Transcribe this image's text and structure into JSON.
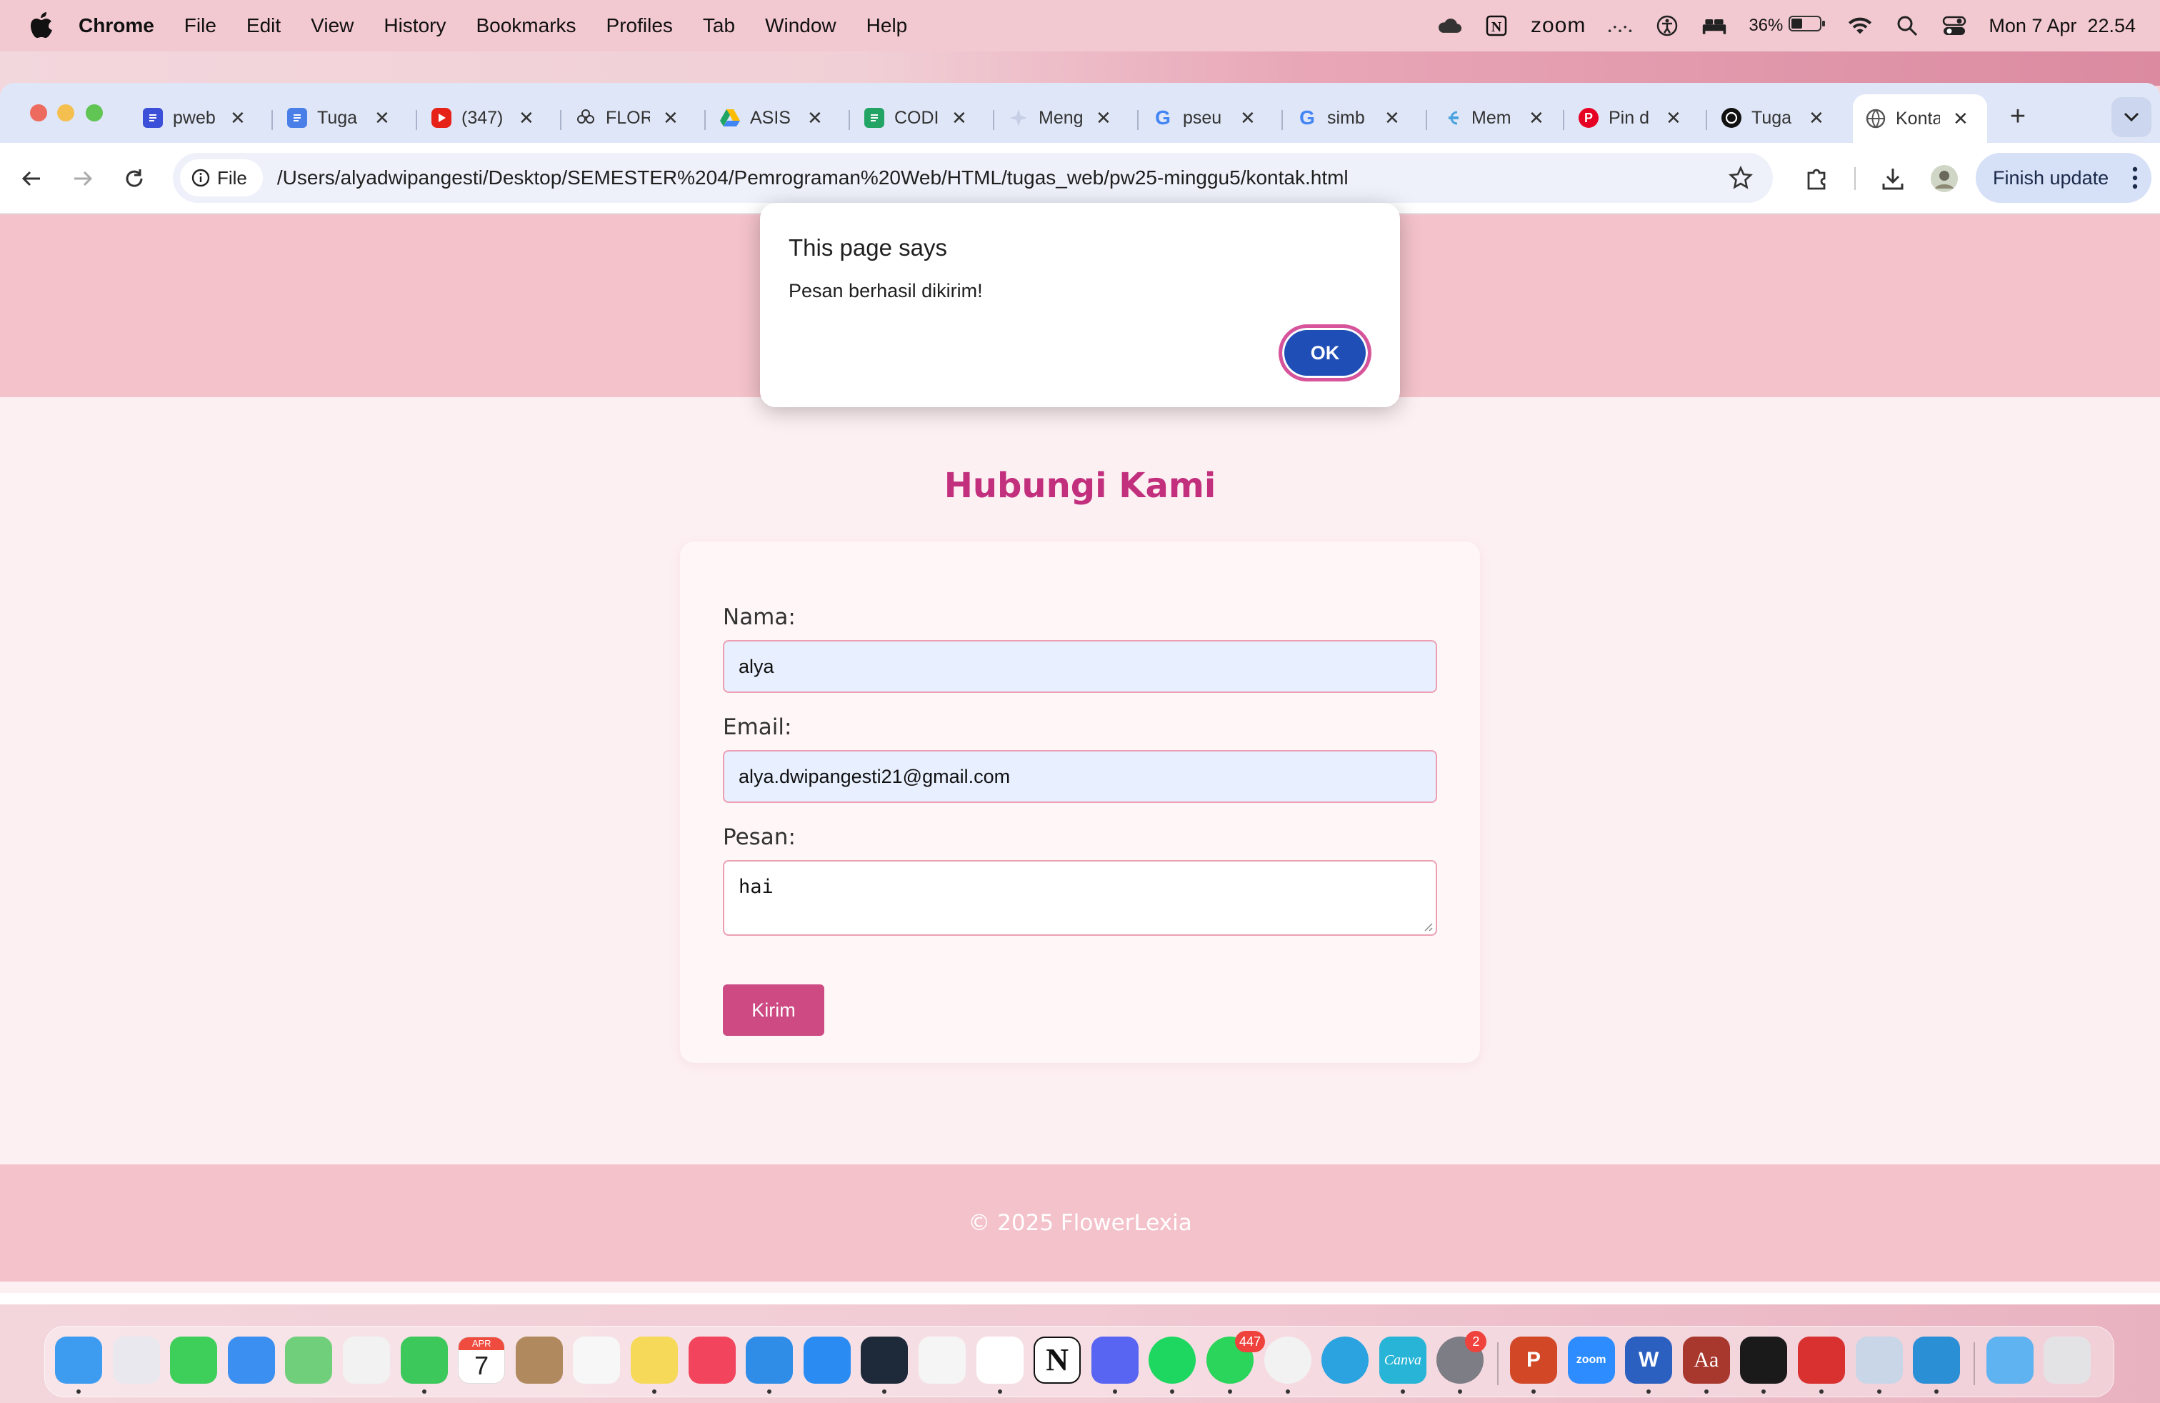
{
  "menubar": {
    "app_name": "Chrome",
    "items": [
      "File",
      "Edit",
      "View",
      "History",
      "Bookmarks",
      "Profiles",
      "Tab",
      "Window",
      "Help"
    ],
    "zoom_label": "zoom",
    "battery_percent": "36%",
    "datetime": "Mon 7 Apr  22.54"
  },
  "browser": {
    "tabs": [
      {
        "label": "pweb",
        "icon": "doc-blue-icon",
        "color": "#3b4fd8"
      },
      {
        "label": "Tuga",
        "icon": "google-docs-icon",
        "color": "#4a7fe8"
      },
      {
        "label": "(347)",
        "icon": "youtube-icon",
        "color": "#e62117"
      },
      {
        "label": "FLOR",
        "icon": "flower-icon",
        "color": "#333333"
      },
      {
        "label": "ASIS",
        "icon": "google-drive-icon",
        "color": "#f4b400"
      },
      {
        "label": "CODI",
        "icon": "google-sheets-icon",
        "color": "#21a464"
      },
      {
        "label": "Meng",
        "icon": "sparkle-icon",
        "color": "#b8c4e0"
      },
      {
        "label": "pseu",
        "icon": "google-icon",
        "color": "#4285f4"
      },
      {
        "label": "simb",
        "icon": "google-icon",
        "color": "#4285f4"
      },
      {
        "label": "Mem",
        "icon": "link-icon",
        "color": "#4aa3df"
      },
      {
        "label": "Pin d",
        "icon": "pinterest-icon",
        "color": "#e60023"
      },
      {
        "label": "Tuga",
        "icon": "openai-icon",
        "color": "#111111"
      },
      {
        "label": "Konta",
        "icon": "globe-icon",
        "color": "#555555"
      }
    ],
    "site_chip": "File",
    "url": "/Users/alyadwipangesti/Desktop/SEMESTER%204/Pemrograman%20Web/HTML/tugas_web/pw25-minggu5/kontak.html",
    "finish_update": "Finish update"
  },
  "page": {
    "title": "Hubungi Kami",
    "form": {
      "name_label": "Nama:",
      "name_value": "alya",
      "email_label": "Email:",
      "email_value": "alya.dwipangesti21@gmail.com",
      "message_label": "Pesan:",
      "message_value": "hai",
      "submit_label": "Kirim"
    },
    "footer": "© 2025 FlowerLexia"
  },
  "dialog": {
    "title": "This page says",
    "message": "Pesan berhasil dikirim!",
    "ok_label": "OK"
  },
  "dock": {
    "whatsapp_badge": "447",
    "settings_badge": "2",
    "calendar_month": "APR",
    "calendar_day": "7",
    "apps": [
      {
        "name": "finder",
        "color": "#3d9cf0"
      },
      {
        "name": "launchpad",
        "color": "#e8e8ee"
      },
      {
        "name": "messages",
        "color": "#3ecf5a"
      },
      {
        "name": "mail",
        "color": "#3a8ff0"
      },
      {
        "name": "maps",
        "color": "#6fcf7a"
      },
      {
        "name": "photos",
        "color": "#f2f2f2"
      },
      {
        "name": "facetime",
        "color": "#3cc85a"
      },
      {
        "name": "calendar",
        "color": "#ffffff"
      },
      {
        "name": "contacts",
        "color": "#b08a5e"
      },
      {
        "name": "reminders",
        "color": "#f7f7f7"
      },
      {
        "name": "notes",
        "color": "#f7d95a"
      },
      {
        "name": "music",
        "color": "#f2445c"
      },
      {
        "name": "keynote",
        "color": "#2f8de8"
      },
      {
        "name": "app-store",
        "color": "#2a8bf2"
      },
      {
        "name": "cursor",
        "color": "#1e2a3a"
      },
      {
        "name": "blender",
        "color": "#f5f5f5"
      },
      {
        "name": "capcut",
        "color": "#ffffff"
      },
      {
        "name": "notion",
        "color": "#ffffff"
      },
      {
        "name": "discord",
        "color": "#5865f2"
      },
      {
        "name": "spotify",
        "color": "#1ed760"
      },
      {
        "name": "whatsapp",
        "color": "#2bd45b"
      },
      {
        "name": "chrome",
        "color": "#f2f2f2"
      },
      {
        "name": "telegram",
        "color": "#2aa3e0"
      },
      {
        "name": "canva",
        "color": "#27b4d6"
      },
      {
        "name": "system-settings",
        "color": "#7d7d85"
      },
      {
        "name": "powerpoint",
        "color": "#d24726"
      },
      {
        "name": "zoom",
        "color": "#2d8cff"
      },
      {
        "name": "word",
        "color": "#2b5fc0"
      },
      {
        "name": "dictionary",
        "color": "#a8382e"
      },
      {
        "name": "terminal",
        "color": "#1a1a1a"
      },
      {
        "name": "photo-booth",
        "color": "#d93030"
      },
      {
        "name": "preview",
        "color": "#c9d6e8"
      },
      {
        "name": "vscode",
        "color": "#2b8fd6"
      },
      {
        "name": "applications-folder",
        "color": "#5eb3f0"
      },
      {
        "name": "trash",
        "color": "#e3e3e6"
      }
    ]
  },
  "colors": {
    "accent_pink": "#c2307d",
    "button_pink": "#cd4a83",
    "header_pink": "#f4c2cb",
    "dialog_ok_blue": "#1f4fb6"
  }
}
